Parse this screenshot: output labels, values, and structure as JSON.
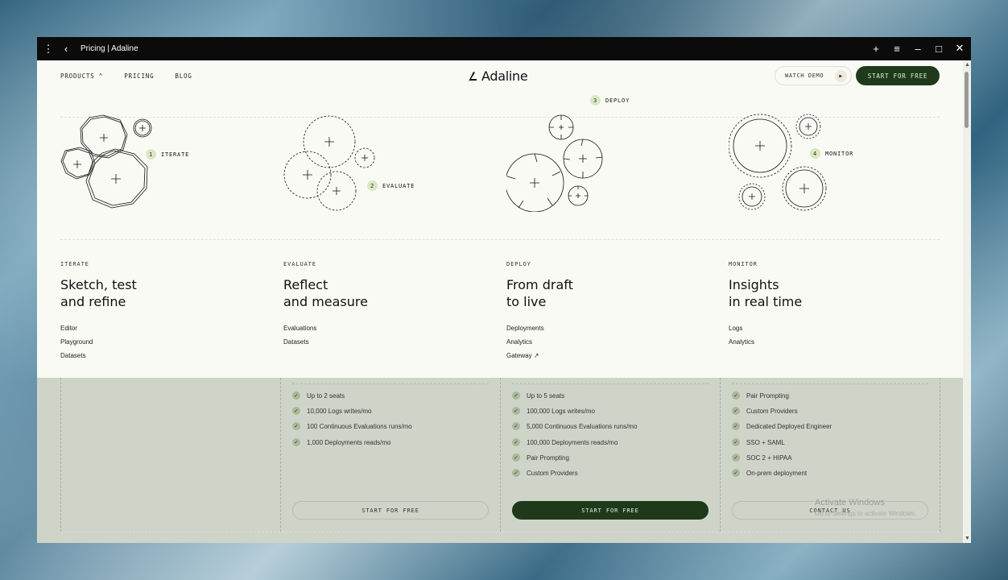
{
  "window": {
    "title": "Pricing | Adaline",
    "icons": [
      "more-vertical-icon",
      "back-icon",
      "new-tab-icon",
      "menu-icon",
      "minimize-icon",
      "maximize-icon",
      "close-icon"
    ]
  },
  "nav": {
    "products": "PRODUCTS",
    "pricing": "PRICING",
    "blog": "BLOG",
    "logo": "Adaline",
    "watch_demo": "WATCH DEMO",
    "start_free": "START FOR FREE"
  },
  "menu": {
    "columns": [
      {
        "badge_num": "1",
        "badge_label": "ITERATE",
        "tag": "ITERATE",
        "title_line1": "Sketch, test",
        "title_line2": "and refine",
        "links": [
          "Editor",
          "Playground",
          "Datasets"
        ]
      },
      {
        "badge_num": "2",
        "badge_label": "EVALUATE",
        "tag": "EVALUATE",
        "title_line1": "Reflect",
        "title_line2": "and measure",
        "links": [
          "Evaluations",
          "Datasets"
        ]
      },
      {
        "badge_num": "3",
        "badge_label": "DEPLOY",
        "tag": "DEPLOY",
        "title_line1": "From draft",
        "title_line2": "to live",
        "links": [
          "Deployments",
          "Analytics",
          "Gateway ↗"
        ]
      },
      {
        "badge_num": "4",
        "badge_label": "MONITOR",
        "tag": "MONITOR",
        "title_line1": "Insights",
        "title_line2": "in real time",
        "links": [
          "Logs",
          "Analytics"
        ]
      }
    ]
  },
  "pricing": {
    "cards": [
      {
        "features": [
          "Up to 2 seats",
          "10,000 Logs writes/mo",
          "100 Continuous Evaluations runs/mo",
          "1,000 Deployments reads/mo"
        ],
        "button": "START FOR FREE"
      },
      {
        "features": [
          "Up to 5 seats",
          "100,000 Logs writes/mo",
          "5,000 Continuous Evaluations runs/mo",
          "100,000 Deployments reads/mo",
          "Pair Prompting",
          "Custom Providers"
        ],
        "button": "START FOR FREE"
      },
      {
        "features": [
          "Pair Prompting",
          "Custom Providers",
          "Dedicated Deployed Engineer",
          "SSO + SAML",
          "SOC 2 + HIPAA",
          "On-prem deployment"
        ],
        "button": "CONTACT US"
      }
    ]
  },
  "watermark": {
    "line1": "Activate Windows",
    "line2": "Go to Settings to activate Windows."
  },
  "colors": {
    "brand_dark": "#1e3a1b",
    "badge_bg": "#dbe7c4",
    "page_bg": "#fafaf5"
  }
}
